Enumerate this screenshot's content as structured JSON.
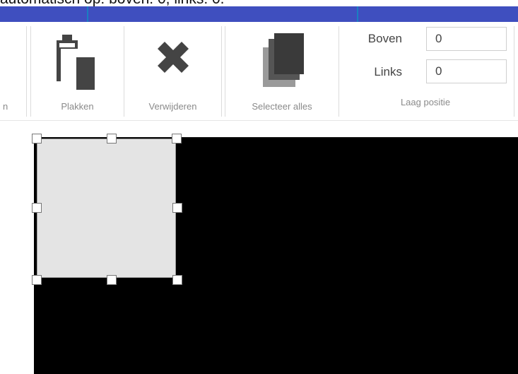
{
  "caption": "automatisch op: boven: 0, links: 0.",
  "ribbon": {
    "edge_label": "n",
    "buttons": [
      {
        "label": "Plakken",
        "icon": "clipboard-paste-icon"
      },
      {
        "label": "Verwijderen",
        "icon": "delete-x-icon"
      },
      {
        "label": "Selecteer alles",
        "icon": "select-all-icon"
      }
    ],
    "position": {
      "top_label": "Boven",
      "top_value": "0",
      "left_label": "Links",
      "left_value": "0",
      "group_label": "Laag positie"
    }
  },
  "colors": {
    "title_bar": "#3f4fbf",
    "canvas": "#000000",
    "layer": "#e4e4e4",
    "icon": "#444444"
  }
}
